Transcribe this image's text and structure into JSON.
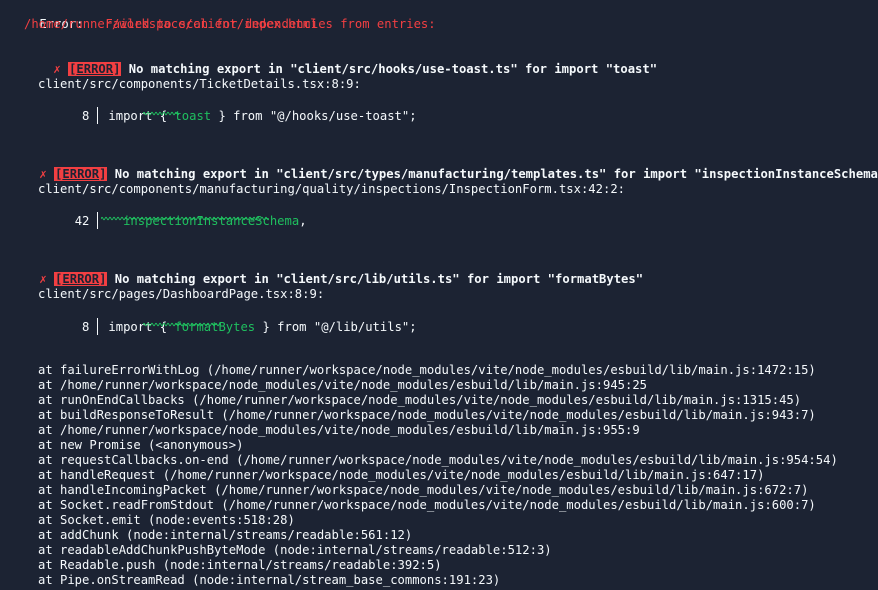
{
  "header": {
    "label": "Error:",
    "message": "Failed to scan for dependencies from entries:",
    "path": "/home/runner/workspace/client/index.html"
  },
  "errors": [
    {
      "mark": "✗",
      "badge": "ERROR",
      "message": "No matching export in \"client/src/hooks/use-toast.ts\" for import \"toast\"",
      "location": "client/src/components/TicketDetails.tsx:8:9:",
      "line_number": "8",
      "code_before": "import { ",
      "code_highlight": "toast",
      "code_after": " } from \"@/hooks/use-toast\";"
    },
    {
      "mark": "✗",
      "badge": "ERROR",
      "message": "No matching export in \"client/src/types/manufacturing/templates.ts\" for import \"inspectionInstanceSchema\"",
      "location": "client/src/components/manufacturing/quality/inspections/InspectionForm.tsx:42:2:",
      "line_number": "42",
      "code_before": "  ",
      "code_highlight": "inspectionInstanceSchema",
      "code_after": ","
    },
    {
      "mark": "✗",
      "badge": "ERROR",
      "message": "No matching export in \"client/src/lib/utils.ts\" for import \"formatBytes\"",
      "location": "client/src/pages/DashboardPage.tsx:8:9:",
      "line_number": "8",
      "code_before": "import { ",
      "code_highlight": "formatBytes",
      "code_after": " } from \"@/lib/utils\";"
    }
  ],
  "stack": [
    "at failureErrorWithLog (/home/runner/workspace/node_modules/vite/node_modules/esbuild/lib/main.js:1472:15)",
    "at /home/runner/workspace/node_modules/vite/node_modules/esbuild/lib/main.js:945:25",
    "at runOnEndCallbacks (/home/runner/workspace/node_modules/vite/node_modules/esbuild/lib/main.js:1315:45)",
    "at buildResponseToResult (/home/runner/workspace/node_modules/vite/node_modules/esbuild/lib/main.js:943:7)",
    "at /home/runner/workspace/node_modules/vite/node_modules/esbuild/lib/main.js:955:9",
    "at new Promise (<anonymous>)",
    "at requestCallbacks.on-end (/home/runner/workspace/node_modules/vite/node_modules/esbuild/lib/main.js:954:54)",
    "at handleRequest (/home/runner/workspace/node_modules/vite/node_modules/esbuild/lib/main.js:647:17)",
    "at handleIncomingPacket (/home/runner/workspace/node_modules/vite/node_modules/esbuild/lib/main.js:672:7)",
    "at Socket.readFromStdout (/home/runner/workspace/node_modules/vite/node_modules/esbuild/lib/main.js:600:7)",
    "at Socket.emit (node:events:518:28)",
    "at addChunk (node:internal/streams/readable:561:12)",
    "at readableAddChunkPushByteMode (node:internal/streams/readable:512:3)",
    "at Readable.push (node:internal/streams/readable:392:5)",
    "at Pipe.onStreamRead (node:internal/stream_base_commons:191:23)"
  ],
  "colors": {
    "background": "#1c2333",
    "text": "#f5f9fc",
    "error": "#f23f42",
    "highlight": "#1fbf5f"
  }
}
